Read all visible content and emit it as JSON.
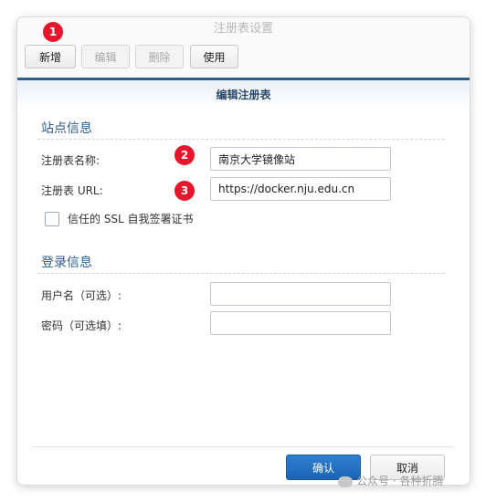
{
  "window": {
    "title": "注册表设置"
  },
  "toolbar": {
    "add": "新增",
    "edit": "编辑",
    "delete": "删除",
    "use": "使用"
  },
  "subheader": "编辑注册表",
  "site_info": {
    "title": "站点信息",
    "name_label": "注册表名称:",
    "name_value": "南京大学镜像站",
    "url_label": "注册表 URL:",
    "url_value": "https://docker.nju.edu.cn",
    "ssl_label": "信任的 SSL 自我签署证书"
  },
  "login_info": {
    "title": "登录信息",
    "username_label": "用户名（可选）:",
    "password_label": "密码（可选填）:"
  },
  "footer": {
    "ok": "确认",
    "cancel": "取消"
  },
  "badges": [
    "1",
    "2",
    "3"
  ],
  "watermark": "公众号 · 各种折腾",
  "colors": {
    "accent": "#1c64b5",
    "header": "#2f5d8a",
    "badge": "#e8162a"
  }
}
